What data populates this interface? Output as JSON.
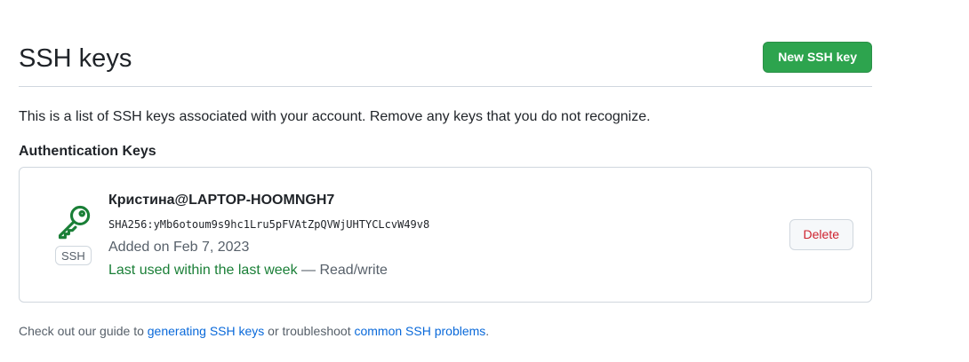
{
  "header": {
    "title": "SSH keys",
    "new_key_label": "New SSH key"
  },
  "intro_text": "This is a list of SSH keys associated with your account. Remove any keys that you do not recognize.",
  "section_title": "Authentication Keys",
  "keys": [
    {
      "title": "Кристина@LAPTOP-HOOMNGH7",
      "fingerprint": "SHA256:yMb6otoum9s9hc1Lru5pFVAtZpQVWjUHTYCLcvW49v8",
      "added": "Added on Feb 7, 2023",
      "last_used": "Last used within the last week",
      "access_sep": " — ",
      "access": "Read/write",
      "type_badge": "SSH",
      "icon": "key-icon",
      "delete_label": "Delete"
    }
  ],
  "footer": {
    "prefix": "Check out our guide to ",
    "link1": "generating SSH keys",
    "middle": " or troubleshoot ",
    "link2": "common SSH problems",
    "suffix": "."
  },
  "colors": {
    "primary_button": "#2da44e",
    "key_icon": "#1a7f37",
    "last_used": "#1a7f37",
    "danger": "#cf222e",
    "link": "#0969da"
  }
}
